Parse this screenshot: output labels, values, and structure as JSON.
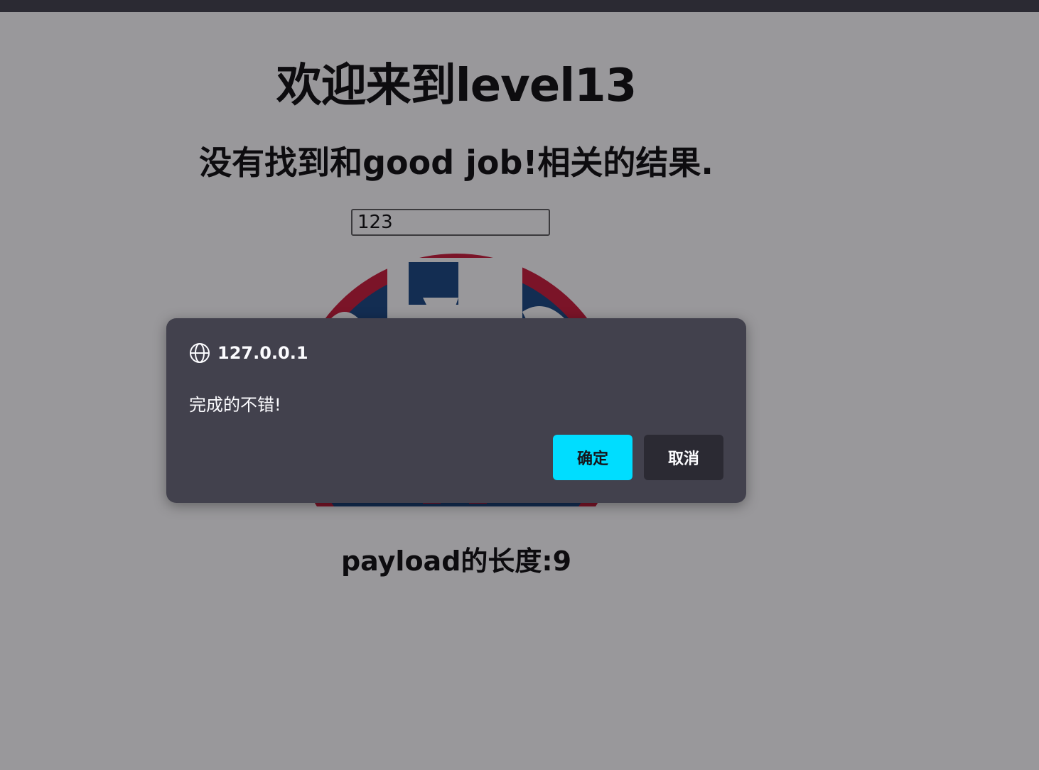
{
  "page": {
    "title": "欢迎来到level13",
    "result_text": "没有找到和good job!相关的结果.",
    "search_value": "123",
    "payload_length": "payload的长度:9"
  },
  "dialog": {
    "origin": "127.0.0.1",
    "message": "完成的不错!",
    "ok_label": "确定",
    "cancel_label": "取消"
  },
  "colors": {
    "dialog_bg": "#42414d",
    "ok_button": "#00ddff",
    "cancel_button": "#2b2a33",
    "topbar": "#2b2a33"
  },
  "icons": {
    "dialog_origin": "globe-icon"
  }
}
